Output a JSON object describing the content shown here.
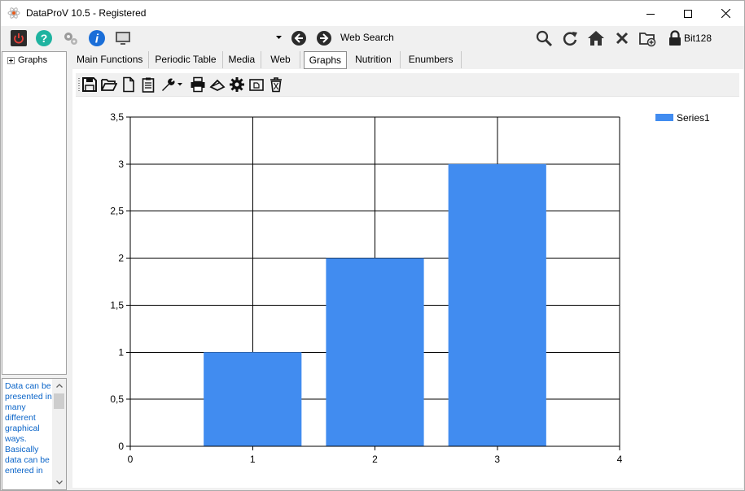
{
  "window": {
    "title": "DataProV 10.5 - Registered"
  },
  "toolbar": {
    "web_search_label": "Web Search",
    "bit_label": "Bit128",
    "icons": [
      "power-icon",
      "help-icon",
      "gears-icon",
      "info-icon",
      "monitor-icon",
      "back-arrow-icon",
      "forward-arrow-icon",
      "search-icon",
      "refresh-icon",
      "home-icon",
      "close-icon",
      "add-folder-icon",
      "lock-icon"
    ]
  },
  "tree": {
    "root_label": "Graphs"
  },
  "description": {
    "text": "Data can be presented in many different graphical ways. Basically data can be entered in"
  },
  "tabs": [
    {
      "label": "Main Functions"
    },
    {
      "label": "Periodic Table"
    },
    {
      "label": "Media"
    },
    {
      "label": "Web"
    },
    {
      "label": "Graphs",
      "active": true
    },
    {
      "label": "Nutrition"
    },
    {
      "label": "Enumbers"
    }
  ],
  "graph_toolbar": {
    "icons": [
      "save-icon",
      "open-folder-icon",
      "new-document-icon",
      "clipboard-icon",
      "wrench-icon",
      "print-icon",
      "scanner-icon",
      "settings-icon",
      "window-icon",
      "trash-icon"
    ]
  },
  "colors": {
    "series": "#418cf0",
    "grid": "#000000"
  },
  "chart_data": {
    "type": "bar",
    "x": [
      1,
      2,
      3
    ],
    "values": [
      1,
      2,
      3
    ],
    "series": [
      {
        "name": "Series1",
        "values": [
          1,
          2,
          3
        ]
      }
    ],
    "xlim": [
      0,
      4
    ],
    "ylim": [
      0,
      3.5
    ],
    "xticks": [
      "0",
      "1",
      "2",
      "3",
      "4"
    ],
    "yticks": [
      "0",
      "0,5",
      "1",
      "1,5",
      "2",
      "2,5",
      "3",
      "3,5"
    ],
    "grid": true,
    "legend": "top-right"
  }
}
